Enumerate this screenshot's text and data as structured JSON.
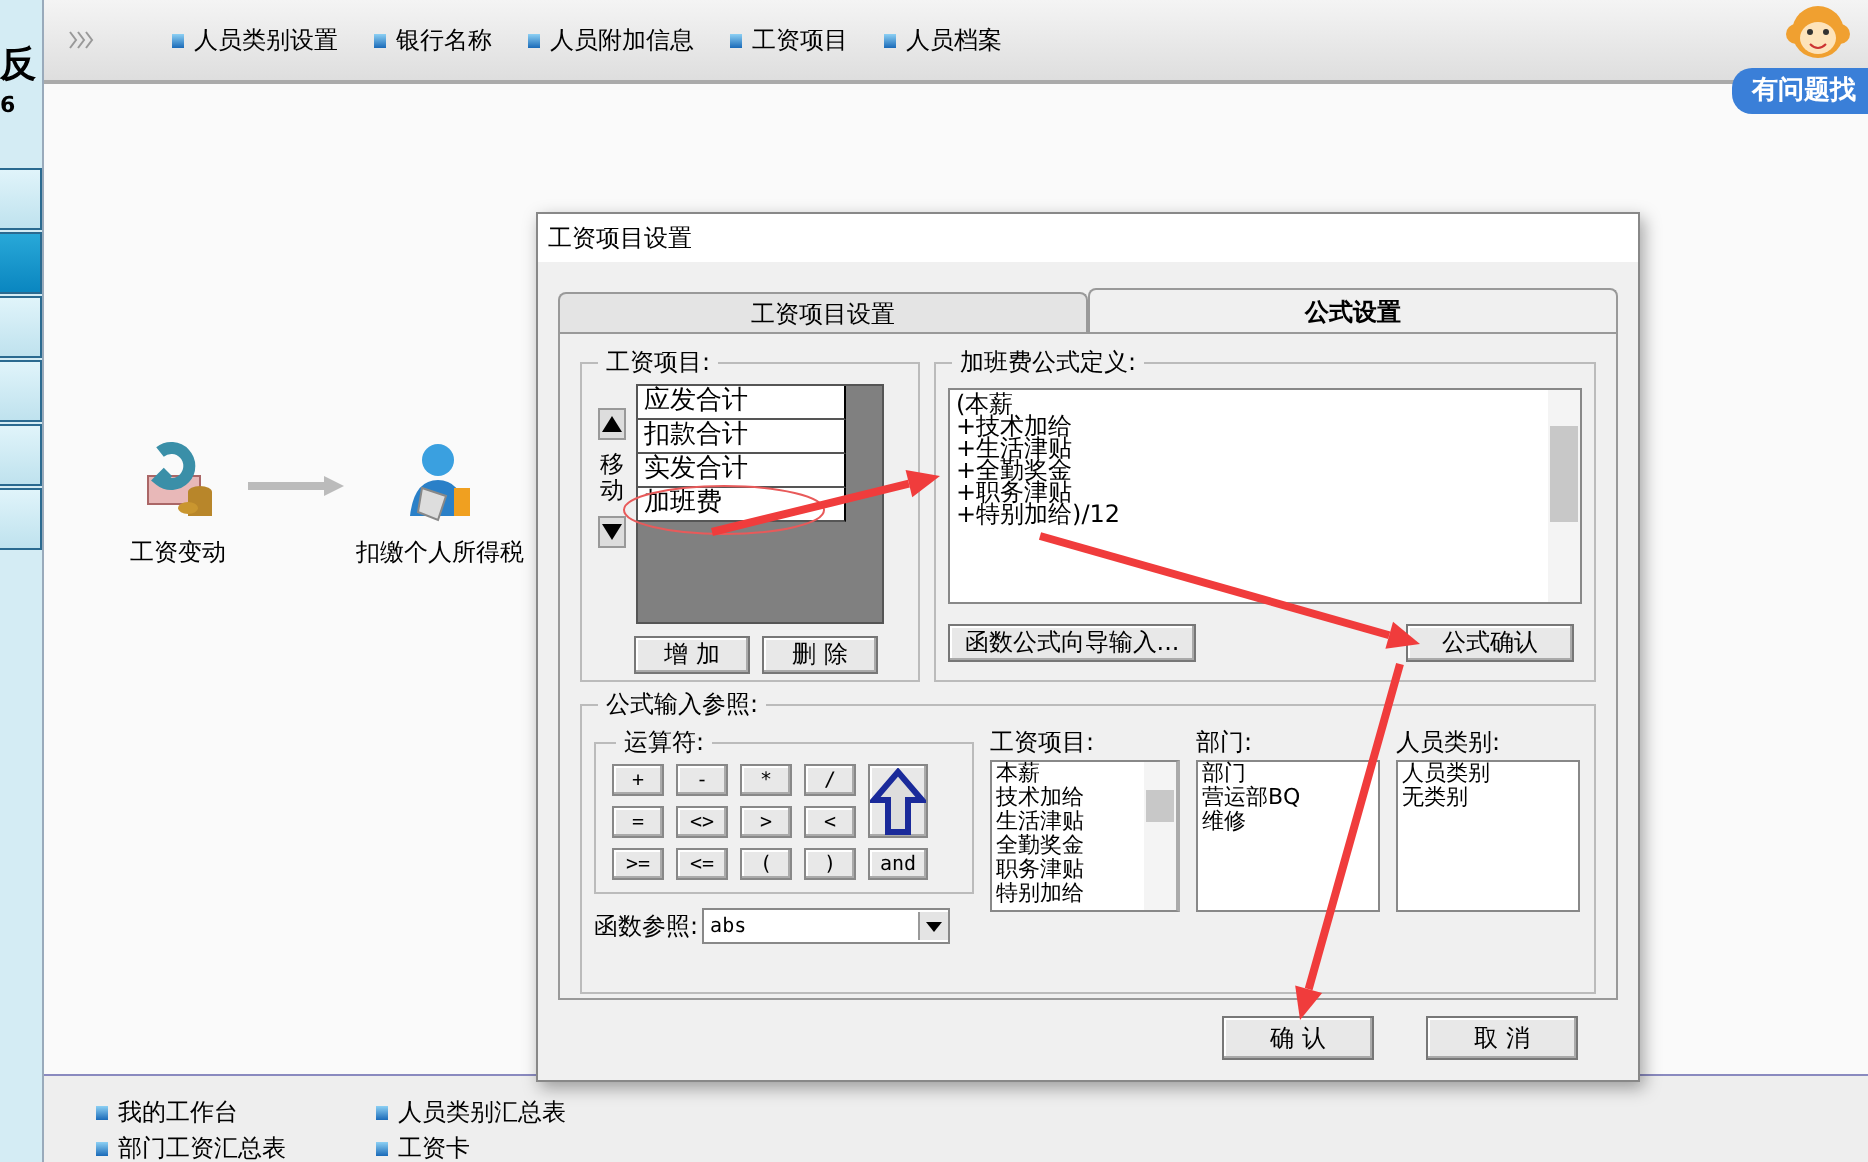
{
  "left_strip": {
    "title_fragment": "反",
    "number_fragment": "6",
    "tabs": [
      {
        "selected": false
      },
      {
        "selected": true
      },
      {
        "selected": false
      },
      {
        "selected": false
      },
      {
        "selected": false
      },
      {
        "selected": false
      }
    ]
  },
  "top_nav": {
    "items": [
      "人员类别设置",
      "银行名称",
      "人员附加信息",
      "工资项目",
      "人员档案"
    ]
  },
  "helper": {
    "label": "有问题找"
  },
  "flow": {
    "nodes": [
      {
        "label": "工资变动",
        "kind": "change"
      },
      {
        "label": "扣缴个人所得税",
        "kind": "tax"
      }
    ]
  },
  "bottom_links": [
    "我的工作台",
    "人员类别汇总表",
    "部门工资汇总表",
    "工资卡"
  ],
  "dialog": {
    "title": "工资项目设置",
    "tabs": [
      {
        "label": "工资项目设置",
        "selected": false
      },
      {
        "label": "公式设置",
        "selected": true
      }
    ],
    "salary_items": {
      "label": "工资项目:",
      "items": [
        "应发合计",
        "扣款合计",
        "实发合计",
        "加班费"
      ],
      "move_label": "移动",
      "buttons": [
        "增 加",
        "删 除"
      ]
    },
    "formula": {
      "label": "加班费公式定义:",
      "lines": [
        "(本薪",
        "+技术加给",
        "+生活津贴",
        "+全勤奖金",
        "+职务津贴",
        "+特别加给)/12"
      ],
      "wizard_button": "函数公式向导输入...",
      "confirm_button": "公式确认"
    },
    "reference": {
      "label": "公式输入参照:",
      "operators_label": "运算符:",
      "operators": [
        "+",
        "-",
        "*",
        "/",
        "=",
        "<>",
        ">",
        "<",
        ">=",
        "<=",
        "(",
        ")",
        "and"
      ],
      "lists": [
        {
          "label": "工资项目:",
          "items": [
            "本薪",
            "技术加给",
            "生活津贴",
            "全勤奖金",
            "职务津贴",
            "特别加给"
          ],
          "scrollable": true
        },
        {
          "label": "部门:",
          "items": [
            "部门",
            "营运部BQ",
            "维修"
          ],
          "scrollable": false
        },
        {
          "label": "人员类别:",
          "items": [
            "人员类别",
            "无类别"
          ],
          "scrollable": false
        }
      ],
      "function_label": "函数参照:",
      "function_value": "abs"
    },
    "buttons": [
      "确 认",
      "取 消"
    ]
  }
}
